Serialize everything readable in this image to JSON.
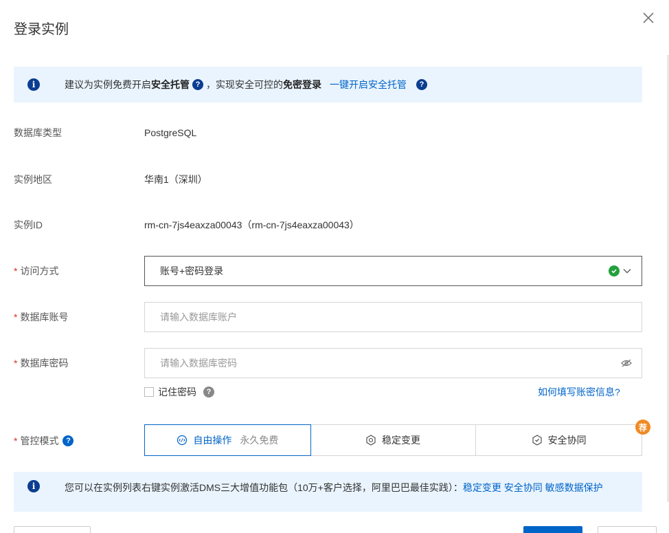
{
  "dialog": {
    "title": "登录实例"
  },
  "notice_top": {
    "part1": "建议为实例免费开启",
    "bold1": "安全托管",
    "part2": "，实现安全可控的",
    "bold2": "免密登录",
    "link": "一键开启安全托管"
  },
  "fields": {
    "db_type": {
      "label": "数据库类型",
      "value": "PostgreSQL"
    },
    "region": {
      "label": "实例地区",
      "value": "华南1（深圳）"
    },
    "instance_id": {
      "label": "实例ID",
      "value": "rm-cn-7js4eaxza00043（rm-cn-7js4eaxza00043）"
    },
    "access": {
      "required": "*",
      "label": "访问方式",
      "value": "账号+密码登录"
    },
    "account": {
      "required": "*",
      "label": "数据库账号",
      "placeholder": "请输入数据库账户"
    },
    "password": {
      "required": "*",
      "label": "数据库密码",
      "placeholder": "请输入数据库密码"
    }
  },
  "remember": {
    "label": "记住密码",
    "help_link": "如何填写账密信息?"
  },
  "control_mode": {
    "required": "*",
    "label": "管控模式",
    "options": [
      {
        "label": "自由操作",
        "sub": "永久免费"
      },
      {
        "label": "稳定变更"
      },
      {
        "label": "安全协同"
      }
    ],
    "badge": "荐"
  },
  "notice_bottom": {
    "text": "您可以在实例列表右键实例激活DMS三大增值功能包（10万+客户选择，阿里巴巴最佳实践）：",
    "link1": "稳定变更",
    "link2": "安全协同",
    "link3": "敏感数据保护"
  },
  "colors": {
    "accent": "#0064c8",
    "notice_bg": "#eaf4fe",
    "required": "#d93026",
    "success": "#23a03c",
    "badge": "#f08a24"
  }
}
